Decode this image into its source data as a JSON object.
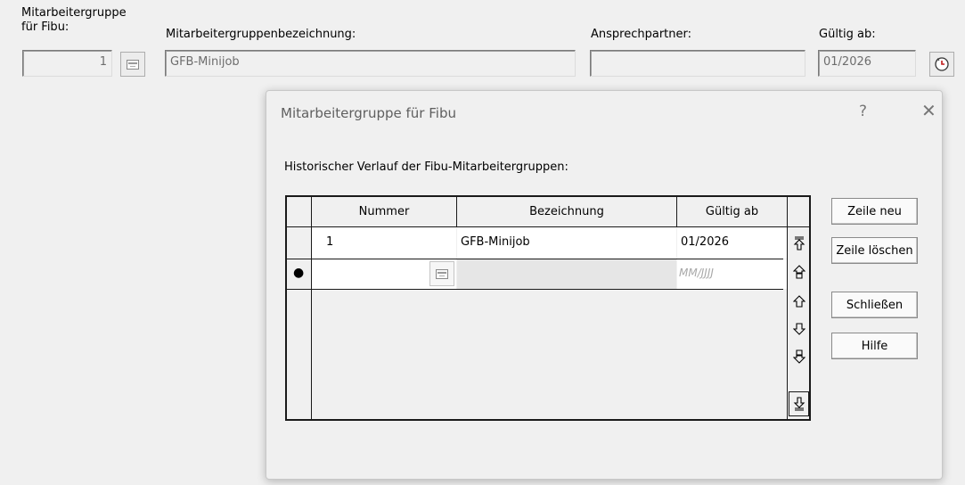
{
  "form": {
    "group_label_line1": "Mitarbeitergruppe",
    "group_label_line2": "für Fibu:",
    "group_value": "1",
    "name_label": "Mitarbeitergruppenbezeichnung:",
    "name_value": "GFB-Minijob",
    "contact_label": "Ansprechpartner:",
    "contact_value": "",
    "valid_label": "Gültig ab:",
    "valid_value": "01/2026"
  },
  "dialog": {
    "title": "Mitarbeitergruppe für Fibu",
    "help_symbol": "?",
    "close_symbol": "✕",
    "section_label": "Historischer Verlauf der Fibu-Mitarbeitergruppen:",
    "columns": [
      "Nummer",
      "Bezeichnung",
      "Gültig ab"
    ],
    "rows": [
      {
        "indicator": "",
        "nummer": "1",
        "bezeichnung": "GFB-Minijob",
        "gueltig_ab": "01/2026"
      },
      {
        "indicator": "●",
        "nummer": "",
        "bezeichnung": "",
        "gueltig_ab_placeholder": "MM/JJJJ"
      }
    ],
    "nav_icons": [
      "first-icon",
      "page-up-icon",
      "up-icon",
      "down-icon",
      "page-down-icon",
      "last-icon"
    ],
    "buttons": {
      "new_row": "Zeile neu",
      "delete_row": "Zeile löschen",
      "close": "Schließen",
      "help": "Hilfe"
    }
  }
}
